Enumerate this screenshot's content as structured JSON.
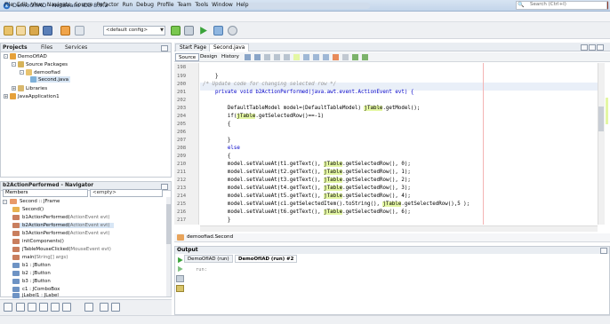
{
  "window": {
    "title": "DemoOfIAD - NetBeans IDE 8.0.2"
  },
  "menu": [
    "File",
    "Edit",
    "View",
    "Navigate",
    "Source",
    "Refactor",
    "Run",
    "Debug",
    "Profile",
    "Team",
    "Tools",
    "Window",
    "Help"
  ],
  "search": {
    "placeholder": "Search (Ctrl+I)"
  },
  "toolbar": {
    "config": "<default config>"
  },
  "projects": {
    "tabs": [
      "Projects",
      "Files",
      "Services"
    ],
    "tree": [
      "DemoOfIAD",
      "Source Packages",
      "demoofiad",
      "Second.java",
      "Libraries",
      "JavaApplication1"
    ]
  },
  "navigator": {
    "title": "b2ActionPerformed - Navigator",
    "members_label": "Members",
    "filter": "<empty>",
    "items": [
      {
        "name": "Second :: JFrame",
        "extra": ""
      },
      {
        "name": "Second()",
        "extra": ""
      },
      {
        "name": "b1ActionPerformed(",
        "extra": "ActionEvent evt)"
      },
      {
        "name": "b2ActionPerformed(",
        "extra": "ActionEvent evt)"
      },
      {
        "name": "b3ActionPerformed(",
        "extra": "ActionEvent evt)"
      },
      {
        "name": "initComponents()",
        "extra": ""
      },
      {
        "name": "jTableMouseClicked(",
        "extra": "MouseEvent evt)"
      },
      {
        "name": "main(",
        "extra": "String[] args)"
      },
      {
        "name": "b1 : JButton",
        "extra": ""
      },
      {
        "name": "b2 : JButton",
        "extra": ""
      },
      {
        "name": "b3 : JButton",
        "extra": ""
      },
      {
        "name": "c1 : JComboBox",
        "extra": ""
      },
      {
        "name": "jLabel1 : JLabel",
        "extra": ""
      }
    ]
  },
  "editor": {
    "tabs": [
      "Start Page",
      "Second.java"
    ],
    "subtabs": [
      "Source",
      "Design",
      "History"
    ],
    "breadcrumb": "demoofiad.Second",
    "lines": [
      {
        "no": "198",
        "text": ""
      },
      {
        "no": "199",
        "text": "    }"
      },
      {
        "no": "200",
        "text": "/* Update code for changing selected row */"
      },
      {
        "no": "201",
        "text": "    private void b2ActionPerformed(java.awt.event.ActionEvent evt) {"
      },
      {
        "no": "202",
        "text": ""
      },
      {
        "no": "203",
        "text": "        DefaultTableModel model=(DefaultTableModel) jTable.getModel();"
      },
      {
        "no": "204",
        "text": "        if(jTable.getSelectedRow()==-1)"
      },
      {
        "no": "205",
        "text": "        {"
      },
      {
        "no": "206",
        "text": ""
      },
      {
        "no": "207",
        "text": "        }"
      },
      {
        "no": "208",
        "text": "        else"
      },
      {
        "no": "209",
        "text": "        {"
      },
      {
        "no": "210",
        "text": "        model.setValueAt(t1.getText(), jTable.getSelectedRow(), 0);"
      },
      {
        "no": "211",
        "text": "        model.setValueAt(t2.getText(), jTable.getSelectedRow(), 1);"
      },
      {
        "no": "212",
        "text": "        model.setValueAt(t3.getText(), jTable.getSelectedRow(), 2);"
      },
      {
        "no": "213",
        "text": "        model.setValueAt(t4.getText(), jTable.getSelectedRow(), 3);"
      },
      {
        "no": "214",
        "text": "        model.setValueAt(t5.getText(), jTable.getSelectedRow(), 4);"
      },
      {
        "no": "215",
        "text": "        model.setValueAt(c1.getSelectedItem().toString(), jTable.getSelectedRow(),5 );"
      },
      {
        "no": "216",
        "text": "        model.setValueAt(t6.getText(), jTable.getSelectedRow(), 6);"
      },
      {
        "no": "217",
        "text": "        }"
      }
    ]
  },
  "output": {
    "title": "Output",
    "tabs": [
      "DemoOfIAD (run)",
      "DemoOfIAD (run) #2"
    ],
    "text": "run:"
  },
  "colors": {
    "highlight": "#e4f7a4",
    "keyword": "#0000c8",
    "comment": "#9a9a9a"
  }
}
